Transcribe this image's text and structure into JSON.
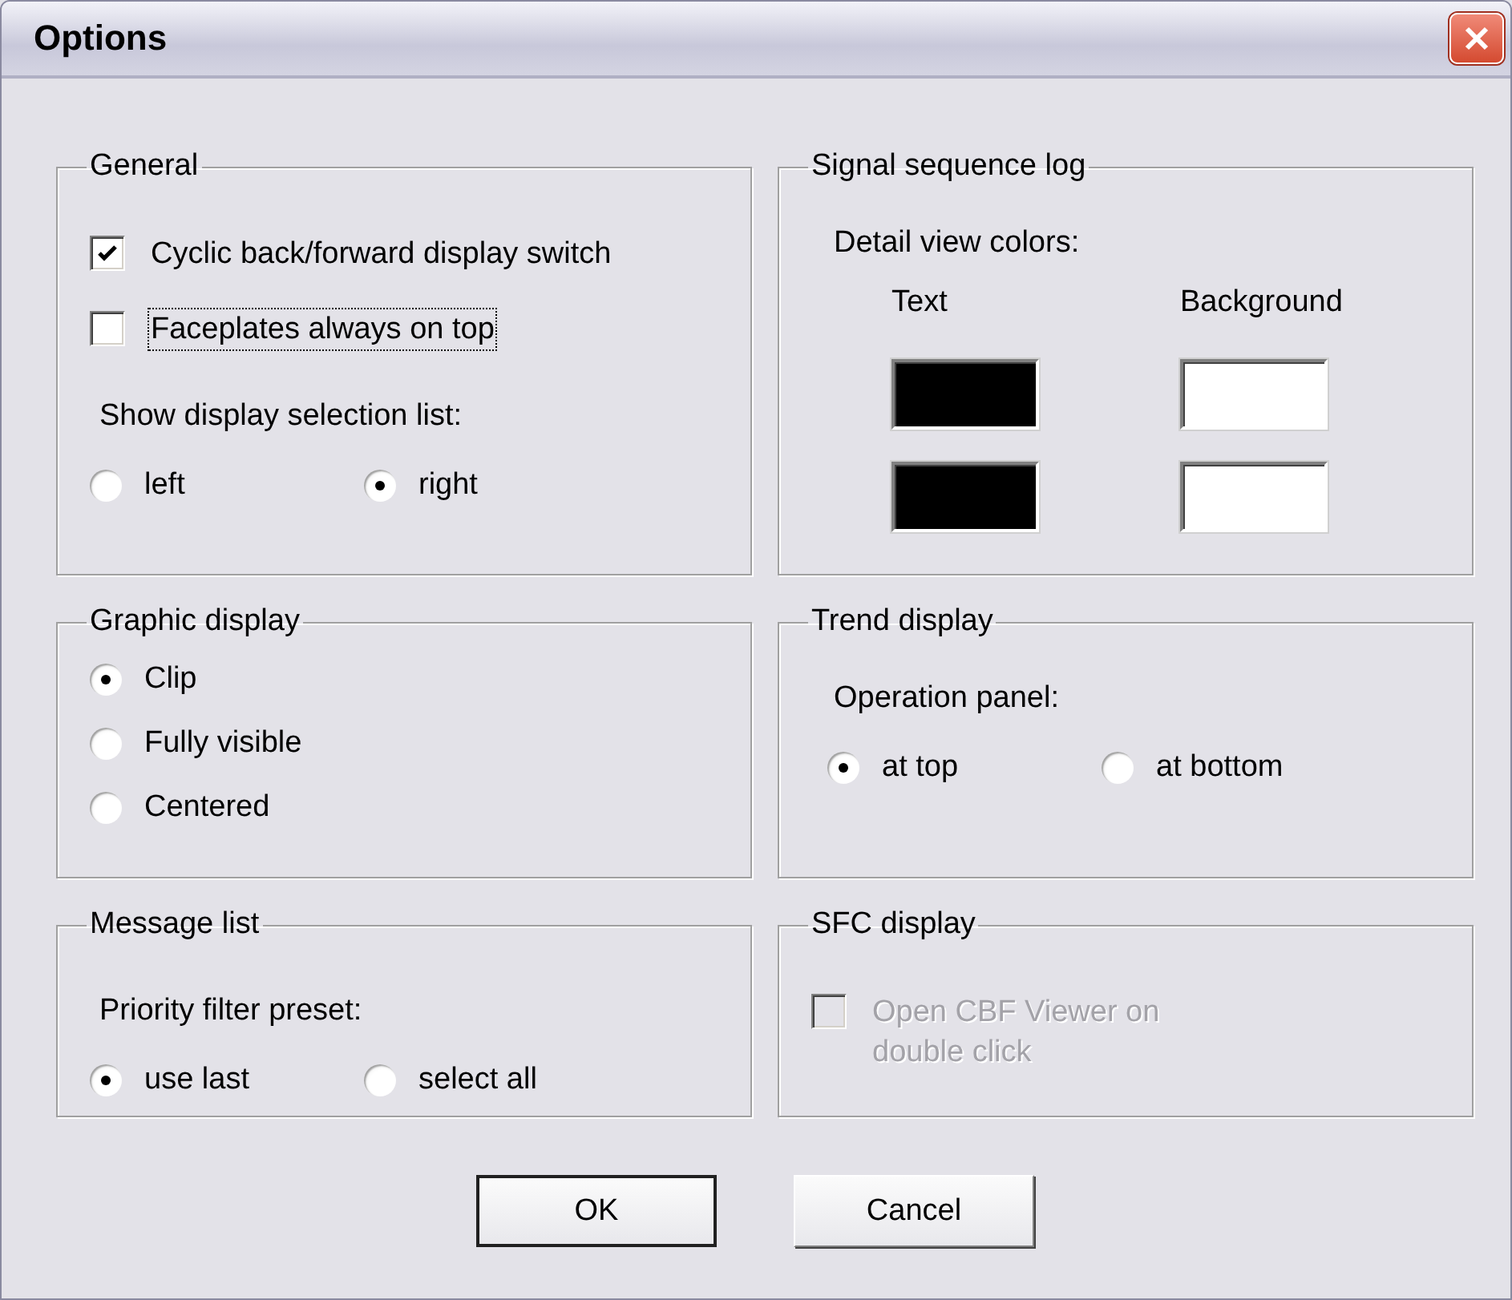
{
  "window": {
    "title": "Options"
  },
  "groups": [
    {
      "title": "General",
      "items": [
        {
          "kind": "checkbox",
          "label": "Cyclic back/forward display switch",
          "checked": true,
          "focused": false,
          "disabled": false
        },
        {
          "kind": "checkbox",
          "label": "Faceplates always on top",
          "checked": false,
          "focused": true,
          "disabled": false
        },
        {
          "kind": "caption",
          "text": "Show display selection list:"
        },
        {
          "kind": "radio_row",
          "options": [
            {
              "label": "left",
              "selected": false
            },
            {
              "label": "right",
              "selected": true
            }
          ]
        }
      ]
    },
    {
      "title": "Signal sequence log",
      "items": [
        {
          "kind": "caption",
          "text": "Detail view colors:"
        },
        {
          "kind": "color_table",
          "columns": [
            {
              "header": "Text",
              "swatches": [
                {
                  "color": "#000000"
                },
                {
                  "color": "#000000"
                }
              ]
            },
            {
              "header": "Background",
              "swatches": [
                {
                  "color": "#ffffff"
                },
                {
                  "color": "#ffffff"
                }
              ]
            }
          ]
        }
      ]
    },
    {
      "title": "Graphic display",
      "items": [
        {
          "kind": "radio_column",
          "options": [
            {
              "label": "Clip",
              "selected": true
            },
            {
              "label": "Fully visible",
              "selected": false
            },
            {
              "label": "Centered",
              "selected": false
            }
          ]
        }
      ]
    },
    {
      "title": "Trend display",
      "items": [
        {
          "kind": "caption",
          "text": "Operation panel:"
        },
        {
          "kind": "radio_row",
          "options": [
            {
              "label": "at top",
              "selected": true
            },
            {
              "label": "at bottom",
              "selected": false
            }
          ]
        }
      ]
    },
    {
      "title": "Message list",
      "items": [
        {
          "kind": "caption",
          "text": "Priority filter preset:"
        },
        {
          "kind": "radio_row",
          "options": [
            {
              "label": "use last",
              "selected": true
            },
            {
              "label": "select all",
              "selected": false
            }
          ]
        }
      ]
    },
    {
      "title": "SFC display",
      "items": [
        {
          "kind": "checkbox",
          "label": "Open CBF Viewer on double click",
          "checked": false,
          "focused": false,
          "disabled": true
        }
      ]
    }
  ],
  "buttons": [
    {
      "label": "OK",
      "default": true
    },
    {
      "label": "Cancel",
      "default": false
    }
  ]
}
